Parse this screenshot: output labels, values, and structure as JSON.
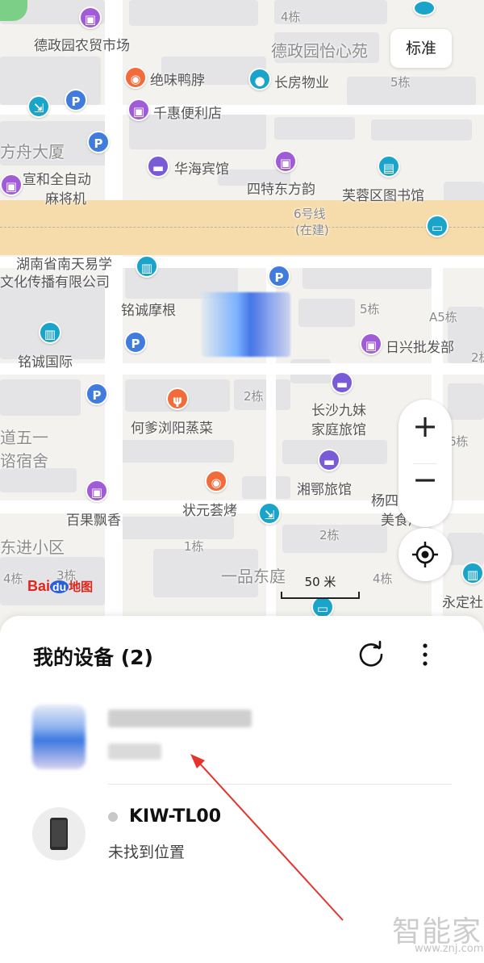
{
  "map": {
    "labels": {
      "dezheng_market": "德政园农贸市场",
      "dezheng_yixin": "德政园怡心苑",
      "b4_top": "4栋",
      "juewei": "绝味鸭脖",
      "changfang": "长房物业",
      "b5_top": "5栋",
      "qianhui": "千惠便利店",
      "fangzhou": "方舟大厦",
      "xuanhe_1": "宣和全自动",
      "xuanhe_2": "麻将机",
      "huahai": "华海宾馆",
      "sitedong": "四特东方韵",
      "furong": "芙蓉区图书馆",
      "line6_1": "6号线",
      "line6_2": "(在建)",
      "hunan_1": "湖南省南天易学",
      "hunan_2": "文化传播有限公司",
      "mingcheng_moto": "铭诚摩根",
      "b5_mid": "5栋",
      "a5": "A5栋",
      "rixing": "日兴批发部",
      "mingcheng_intl": "铭诚国际",
      "b2_mid": "2栋",
      "changsha_1": "长沙九妹",
      "changsha_2": "家庭旅馆",
      "hedie": "何爹浏阳蒸菜",
      "dao5_1": "道五一",
      "dao5_2": "谘宿舍",
      "b6": "6栋",
      "xiange": "湘鄂旅馆",
      "yangsi_1": "杨四",
      "yangsi_2": "美食广场",
      "baiguo": "百果飘香",
      "zhuangyuan": "状元荟烤",
      "dongjin": "东进小区",
      "b1": "1栋",
      "b2_low": "2栋",
      "b4_left": "4栋",
      "b3": "3栋",
      "yipin": "一品东庭",
      "b4_right": "4栋",
      "yongding": "永定社"
    },
    "standard_button": "标准",
    "zoom_in": "+",
    "zoom_out": "−",
    "logo_bai": "Bai",
    "logo_du": "du",
    "logo_map": "地图",
    "scale_label": "50 米"
  },
  "sheet": {
    "title": "我的设备 (2)",
    "devices": [
      {
        "name": "KIW-TL00",
        "status": "未找到位置"
      }
    ]
  },
  "watermark": {
    "text": "智能家",
    "url": "www.znj.com"
  },
  "colors": {
    "rail": "#f6dcaa",
    "arrow": "#e5342c",
    "park_pin": "#3f7cdb"
  }
}
